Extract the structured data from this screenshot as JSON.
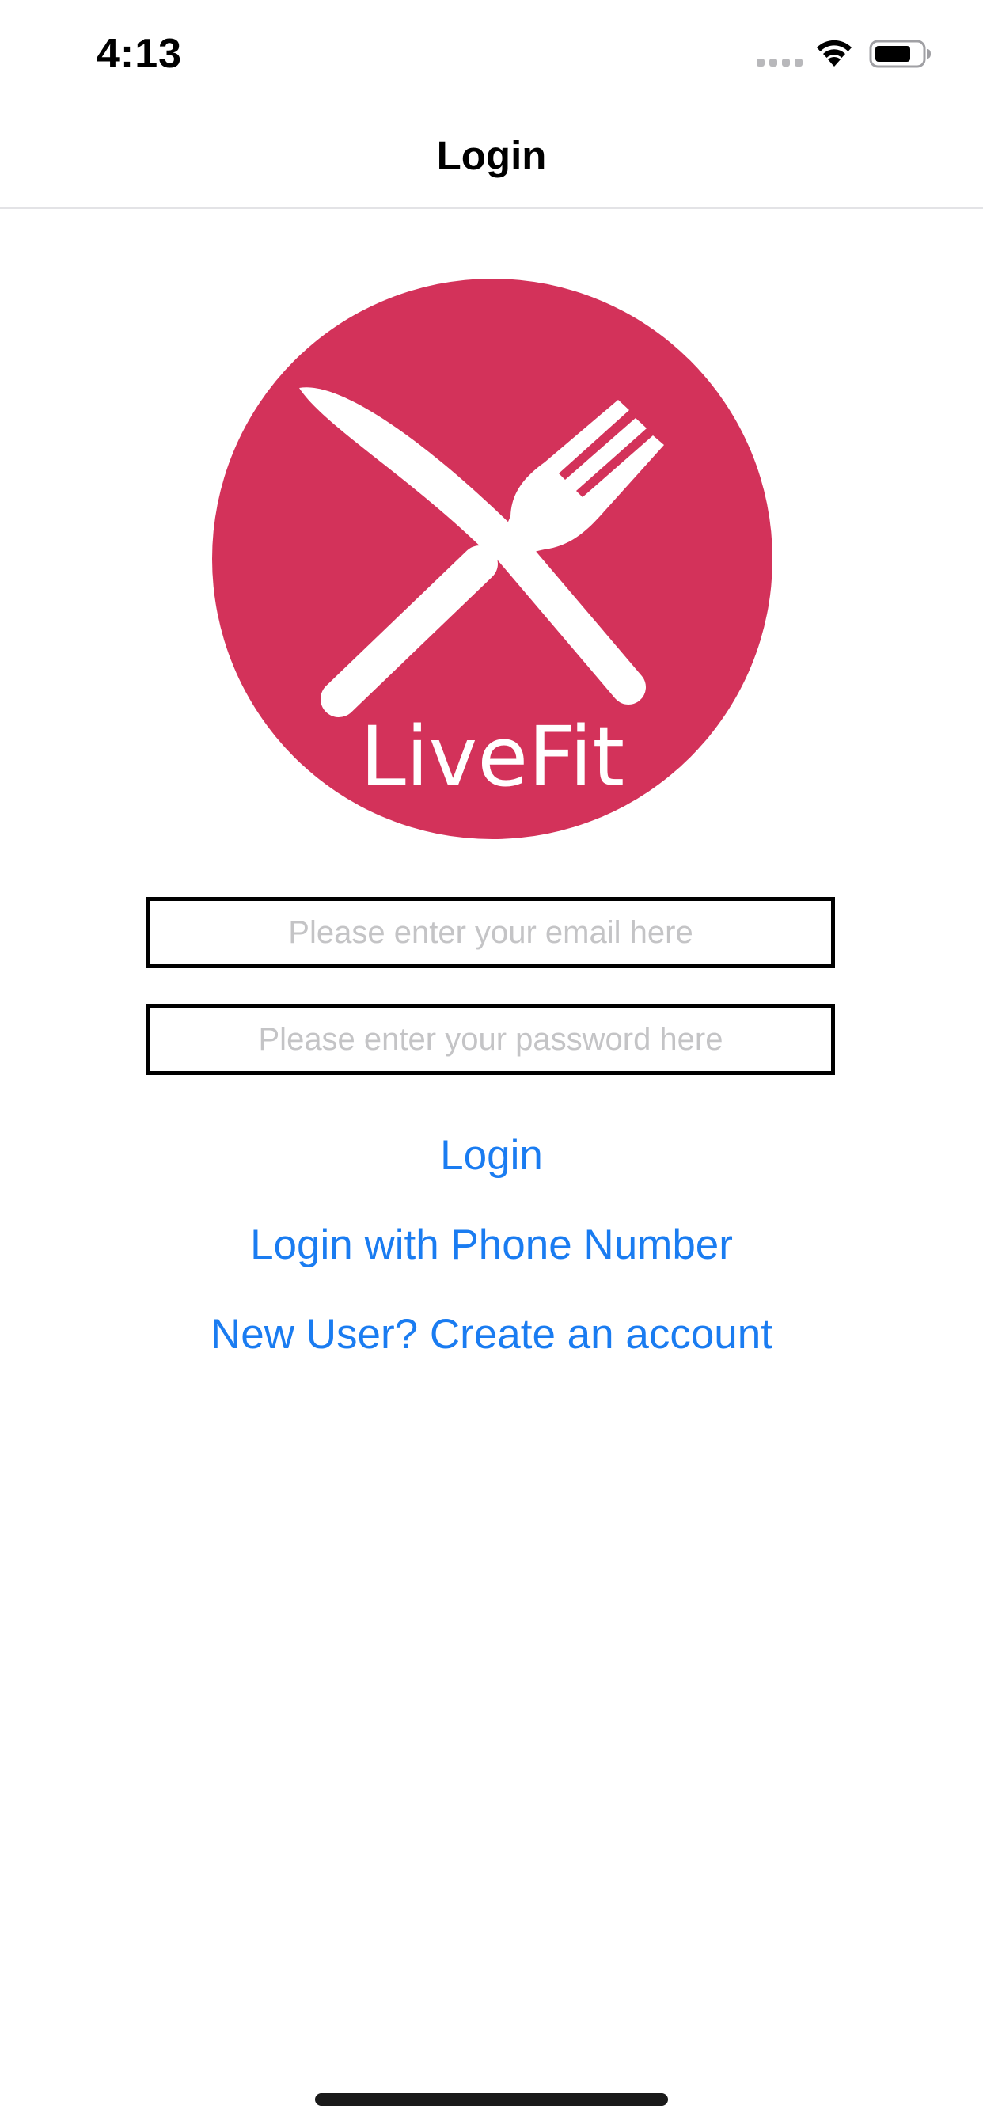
{
  "status_bar": {
    "time": "4:13",
    "signal_icon": "cellular-dots-icon",
    "wifi_icon": "wifi-icon",
    "battery_icon": "battery-icon"
  },
  "nav": {
    "title": "Login"
  },
  "logo": {
    "text": "LiveFit",
    "icon": "fork-and-knife-icon",
    "background_color": "#d3325a",
    "foreground_color": "#ffffff"
  },
  "form": {
    "email_placeholder": "Please enter your email here",
    "email_value": "",
    "password_placeholder": "Please enter your password here",
    "password_value": ""
  },
  "actions": {
    "login_label": "Login",
    "phone_login_label": "Login with Phone Number",
    "create_account_label": "New User? Create an account"
  },
  "colors": {
    "link": "#1a7cf1",
    "placeholder": "#c4c4c6",
    "field_border": "#000000"
  }
}
